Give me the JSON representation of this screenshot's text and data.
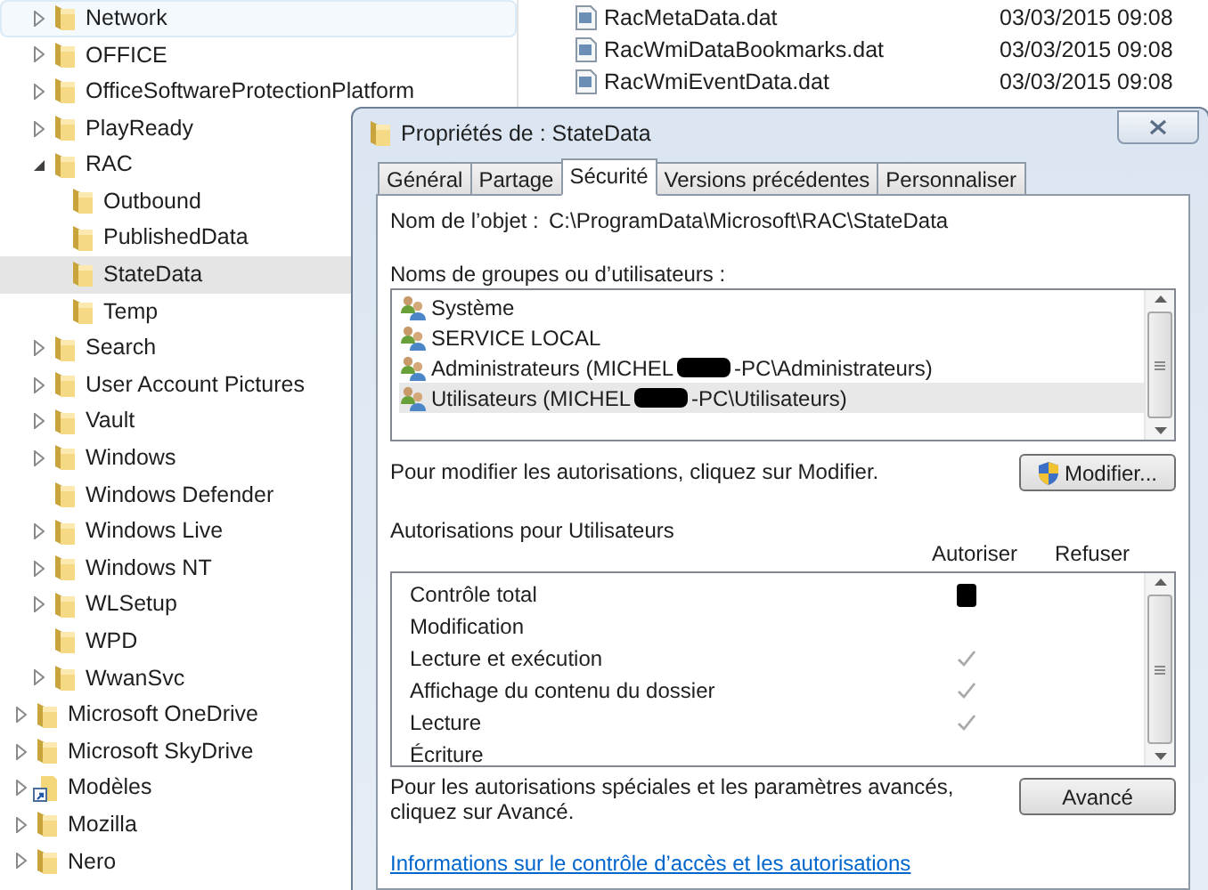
{
  "explorer": {
    "tree": [
      {
        "children": [
          {
            "label": "Network",
            "expandable": true,
            "expanded": false,
            "selected": false,
            "hovered": true,
            "kind": "folder"
          },
          {
            "label": "OFFICE",
            "expandable": true,
            "expanded": false,
            "selected": false,
            "hovered": false,
            "kind": "folder"
          },
          {
            "label": "OfficeSoftwareProtectionPlatform",
            "expandable": true,
            "expanded": false,
            "selected": false,
            "hovered": false,
            "kind": "folder"
          },
          {
            "label": "PlayReady",
            "expandable": true,
            "expanded": false,
            "selected": false,
            "hovered": false,
            "kind": "folder"
          },
          {
            "label": "RAC",
            "expandable": true,
            "expanded": true,
            "selected": false,
            "hovered": false,
            "kind": "folder",
            "children": [
              {
                "label": "Outbound",
                "expandable": false,
                "selected": false,
                "hovered": false,
                "kind": "folder"
              },
              {
                "label": "PublishedData",
                "expandable": false,
                "selected": false,
                "hovered": false,
                "kind": "folder"
              },
              {
                "label": "StateData",
                "expandable": false,
                "selected": true,
                "hovered": false,
                "kind": "folder"
              },
              {
                "label": "Temp",
                "expandable": false,
                "selected": false,
                "hovered": false,
                "kind": "folder"
              }
            ]
          },
          {
            "label": "Search",
            "expandable": true,
            "expanded": false,
            "selected": false,
            "hovered": false,
            "kind": "folder"
          },
          {
            "label": "User Account Pictures",
            "expandable": true,
            "expanded": false,
            "selected": false,
            "hovered": false,
            "kind": "folder"
          },
          {
            "label": "Vault",
            "expandable": true,
            "expanded": false,
            "selected": false,
            "hovered": false,
            "kind": "folder"
          },
          {
            "label": "Windows",
            "expandable": true,
            "expanded": false,
            "selected": false,
            "hovered": false,
            "kind": "folder"
          },
          {
            "label": "Windows Defender",
            "expandable": false,
            "selected": false,
            "hovered": false,
            "kind": "folder"
          },
          {
            "label": "Windows Live",
            "expandable": true,
            "expanded": false,
            "selected": false,
            "hovered": false,
            "kind": "folder"
          },
          {
            "label": "Windows NT",
            "expandable": true,
            "expanded": false,
            "selected": false,
            "hovered": false,
            "kind": "folder"
          },
          {
            "label": "WLSetup",
            "expandable": true,
            "expanded": false,
            "selected": false,
            "hovered": false,
            "kind": "folder"
          },
          {
            "label": "WPD",
            "expandable": false,
            "selected": false,
            "hovered": false,
            "kind": "folder"
          },
          {
            "label": "WwanSvc",
            "expandable": true,
            "expanded": false,
            "selected": false,
            "hovered": false,
            "kind": "folder"
          }
        ]
      },
      {
        "label": "Microsoft OneDrive",
        "expandable": true,
        "expanded": false,
        "selected": false,
        "hovered": false,
        "kind": "folder"
      },
      {
        "label": "Microsoft SkyDrive",
        "expandable": true,
        "expanded": false,
        "selected": false,
        "hovered": false,
        "kind": "folder"
      },
      {
        "label": "Modèles",
        "expandable": true,
        "expanded": false,
        "selected": false,
        "hovered": false,
        "kind": "shortcut"
      },
      {
        "label": "Mozilla",
        "expandable": true,
        "expanded": false,
        "selected": false,
        "hovered": false,
        "kind": "folder"
      },
      {
        "label": "Nero",
        "expandable": true,
        "expanded": false,
        "selected": false,
        "hovered": false,
        "kind": "folder"
      }
    ],
    "files": [
      {
        "name": "RacMetaData.dat",
        "date": "03/03/2015 09:08"
      },
      {
        "name": "RacWmiDataBookmarks.dat",
        "date": "03/03/2015 09:08"
      },
      {
        "name": "RacWmiEventData.dat",
        "date": "03/03/2015 09:08"
      }
    ]
  },
  "dialog": {
    "title": "Propriétés de : StateData",
    "tabs": [
      {
        "label": "Général",
        "selected": false
      },
      {
        "label": "Partage",
        "selected": false
      },
      {
        "label": "Sécurité",
        "selected": true
      },
      {
        "label": "Versions précédentes",
        "selected": false
      },
      {
        "label": "Personnaliser",
        "selected": false
      }
    ],
    "object_label": "Nom de l’objet :",
    "object_path": "C:\\ProgramData\\Microsoft\\RAC\\StateData",
    "groups_label": "Noms de groupes ou d’utilisateurs :",
    "groups": [
      {
        "name": "Système",
        "redacted": false,
        "selected": false
      },
      {
        "name": "SERVICE LOCAL",
        "redacted": false,
        "selected": false
      },
      {
        "name": "Administrateurs (MICHEL",
        "redacted": true,
        "name_after": "-PC\\Administrateurs)",
        "selected": false
      },
      {
        "name": "Utilisateurs (MICHEL",
        "redacted": true,
        "name_after": "-PC\\Utilisateurs)",
        "selected": true
      }
    ],
    "modify_hint": "Pour modifier les autorisations, cliquez sur Modifier.",
    "modify_button": "Modifier...",
    "permissions_label": "Autorisations pour Utilisateurs",
    "columns": [
      "Autoriser",
      "Refuser"
    ],
    "permissions": [
      {
        "label": "Contrôle total",
        "redacted": true
      },
      {
        "label": "Modification",
        "allowed": false,
        "redacted": false
      },
      {
        "label": "Lecture et exécution",
        "allowed": true,
        "redacted": false
      },
      {
        "label": "Affichage du contenu du dossier",
        "allowed": true,
        "redacted": false
      },
      {
        "label": "Lecture",
        "allowed": true,
        "redacted": false
      },
      {
        "label": "Écriture",
        "allowed": false,
        "redacted": false
      }
    ],
    "advanced_hint": "Pour les autorisations spéciales et les paramètres avancés, cliquez sur Avancé.",
    "advanced_button": "Avancé",
    "help_link": "Informations sur le contrôle d’accès et les autorisations"
  }
}
